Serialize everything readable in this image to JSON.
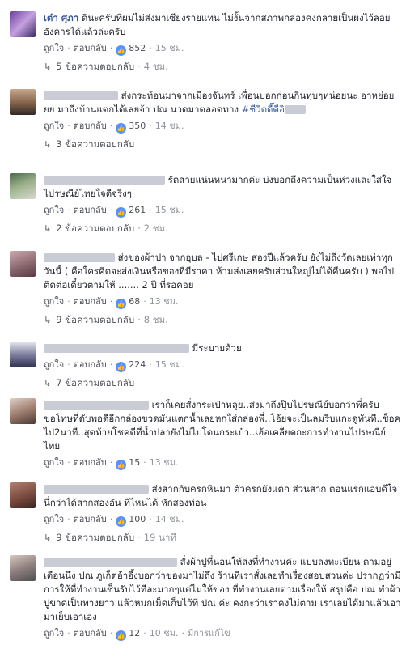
{
  "actions": {
    "like": "ถูกใจ",
    "reply": "ตอบกลับ",
    "sep": "·"
  },
  "comments": [
    {
      "name": "เต๋า ศุภา",
      "text": "ดินะครับที่ผมไม่ส่งมาเซียงรายแทน ไม่งั้นจากสภาพกล่องคงกลายเป็นผงไว้ลอยอังคารได้แล้วล่ะครับ",
      "likes": "852",
      "time": "15 ชม.",
      "replies": "5 ข้อความตอบกลับ",
      "reply_time": "4 ชม."
    },
    {
      "text": "ส่งกระท้อนมาจากเมืองจันทร์ เพื่อนบอกก่อนกินทุบๆหน่อยนะ อาหย่อยยย มาถึงบ้านแตกได้เลยจ้า ปณ นวดมาตลอดทาง",
      "hashtag": "#ชีวิตดี๊ดีอิ",
      "likes": "350",
      "time": "14 ชม.",
      "replies": "3 ข้อความตอบกลับ"
    },
    {
      "text": "รัดสายแน่นหนามากค่ะ บ่งบอกถึงความเป็นห่วงและใส่ใจ ไปรษณีย์ไทยใจดีจริงๆ",
      "likes": "261",
      "time": "15 ชม.",
      "replies": "2 ข้อความตอบกลับ",
      "reply_time": "2 ชม."
    },
    {
      "text": "ส่งของผ้าป่า จากอุบล - ไปศรีเกษ สองปีแล้วครับ ยังไม่ถึงวัดเลยเท่าทุกวันนี้ ( คือใครคิดจะส่งเงินหรือของที่มีราคา ห้ามส่งเลยครับส่วนใหญ่ไม่ได้คืนครับ ) พอไปติดต่อเดี๋ยวตามให้ ....... 2 ปี ที่รอคอย",
      "likes": "68",
      "time": "13 ชม.",
      "replies": "9 ข้อความตอบกลับ",
      "reply_time": "8 ชม."
    },
    {
      "text": "มีระบายด้วย",
      "likes": "224",
      "time": "15 ชม.",
      "replies": "7 ข้อความตอบกลับ"
    },
    {
      "text": "เราก็เคยสั่งกระเป๋าหลุย..ส่งมาถึงปุ๊บไปรษณีย์บอกว่าพี่ครับขอโทษที่ดับพอดีอีกกล่องขวดมันแตกน้ำเลยหกใส่กล่องพี่..โอ้ยจะเป็นลมรีบแกะดูทันที..ช็อคไป2นาที..สุดท้ายโชคดีที่น้ำปลายังไม่ไปโดนกระเป๋า..เฮ้อเคลียดกะการทำงานไปรษณีย์ไทย",
      "likes": "15",
      "time": "13 ชม."
    },
    {
      "text": "ส่งสากกับครกหินมา ตัวครกยังแตก ส่วนสาก ตอนแรกแอบดีใจนี่กว่าได้สากสองอัน ที่ไหนได้ หักสองท่อน",
      "likes": "100",
      "time": "14 ชม.",
      "replies": "9 ข้อความตอบกลับ",
      "reply_time": "19 นาที"
    },
    {
      "text": "สั่งผ้าปูที่นอนให้ส่งที่ทำงานค่ะ แบบลงทะเบียน ตามอยู่เดือนนึง ปณ ภูเก็ตอ้าอึ้งบอกว่าของมาไม่ถึง ร้านที่เราสั่งเลยทำเรื่องสอบสวนค่ะ ปรากฏว่ามีการให้ที่ทำงานเซ็นรับไว้ทีละมากๆแต่ไม่ให้ของ ที่ทำงานเลยตามเรื่องให้ สรุปคือ ปณ ทำผ้าปูขาดเป็นทางยาว แล้วหมกเม็ดเก็บไว้ที่ ปณ ค่ะ คงกะว่าเราคงไม่ตาม เราเลยได้มาแล้วเอามาเย็บเอาเอง",
      "likes": "12",
      "time": "10 ชม.",
      "edited": "มีการแก้ไข"
    }
  ],
  "colors": {
    "link": "#365899",
    "meta": "#90949c",
    "like": "#5890ff"
  }
}
